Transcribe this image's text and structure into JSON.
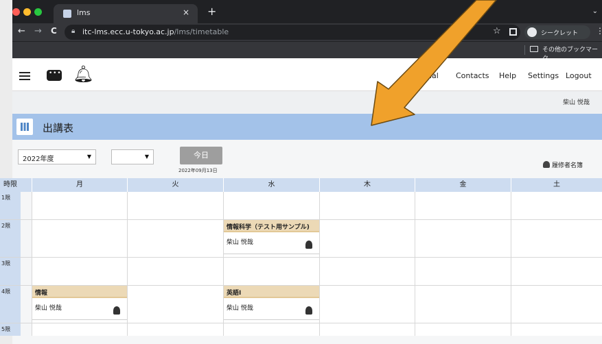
{
  "browser": {
    "tab_title": "lms",
    "tab_close": "×",
    "new_tab": "+",
    "tabs_chevron": "⌄",
    "url_host": "itc-lms.ecc.u-tokyo.ac.jp",
    "url_path": "/lms/timetable",
    "back": "←",
    "forward": "→",
    "reload": "C",
    "star": "☆",
    "incognito_label": "シークレット",
    "menu": "⋮",
    "bookmarks_other": "その他のブックマーク"
  },
  "header": {
    "nav": [
      "ual",
      "Contacts",
      "Help",
      "Settings",
      "Logout"
    ]
  },
  "user": {
    "name": "柴山 悦哉"
  },
  "page": {
    "title": "出講表"
  },
  "controls": {
    "year_select": "2022年度",
    "term_select": "",
    "today_label": "今日",
    "today_date": "2022年09月13日",
    "roster_label": "履修者名簿"
  },
  "timetable": {
    "period_header": "時限",
    "days": [
      "月",
      "火",
      "水",
      "木",
      "金",
      "土"
    ],
    "periods": [
      "1限",
      "2限",
      "3限",
      "4限",
      "5限"
    ],
    "courses": {
      "wed_2": {
        "name": "情報科学（テスト用サンプル)",
        "teacher": "柴山 悦哉"
      },
      "mon_4": {
        "name": "情報",
        "teacher": "柴山 悦哉"
      },
      "wed_4": {
        "name": "英語Ⅰ",
        "teacher": "柴山 悦哉"
      }
    }
  },
  "annotation": {
    "arrow_color": "#f0a12b"
  }
}
